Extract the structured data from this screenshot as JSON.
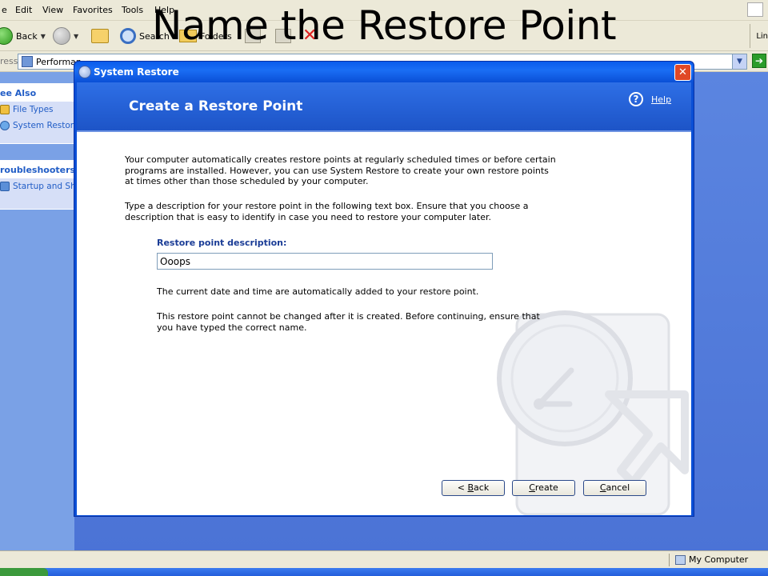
{
  "slide": {
    "title": "Name the Restore Point"
  },
  "explorer": {
    "menu": [
      "e",
      "Edit",
      "View",
      "Favorites",
      "Tools",
      "Help"
    ],
    "toolbar": {
      "back_label": "Back",
      "search_label": "Search",
      "folders_label": "Folders",
      "links_label": "Lin"
    },
    "address": {
      "label": "ress",
      "value": "Performan"
    },
    "left_pane": {
      "see_also": {
        "heading": "ee Also",
        "items": [
          "File Types",
          "System Restore"
        ]
      },
      "troubleshooters": {
        "heading": "roubleshooters",
        "items": [
          "Startup and Shu"
        ]
      }
    },
    "status": {
      "zone": "My Computer"
    }
  },
  "dialog": {
    "title": "System Restore",
    "close_glyph": "✕",
    "banner_title": "Create a Restore Point",
    "help_label": "Help",
    "intro": "Your computer automatically creates restore points at regularly scheduled times or before certain programs are installed. However, you can use System Restore to create your own restore points at times other than those scheduled by your computer.",
    "instruction": "Type a description for your restore point in the following text box. Ensure that you choose a description that is easy to identify in case you need to restore your computer later.",
    "field_label": "Restore point description:",
    "field_value": "Ooops",
    "note_datetime": "The current date and time are automatically added to your restore point.",
    "note_warning": "This restore point cannot be changed after it is created. Before continuing, ensure that you have typed the correct name.",
    "buttons": {
      "back_prefix": "< ",
      "back_underlined": "B",
      "back_rest": "ack",
      "create_underlined": "C",
      "create_rest": "reate",
      "cancel_underlined": "C",
      "cancel_rest": "ancel"
    }
  }
}
